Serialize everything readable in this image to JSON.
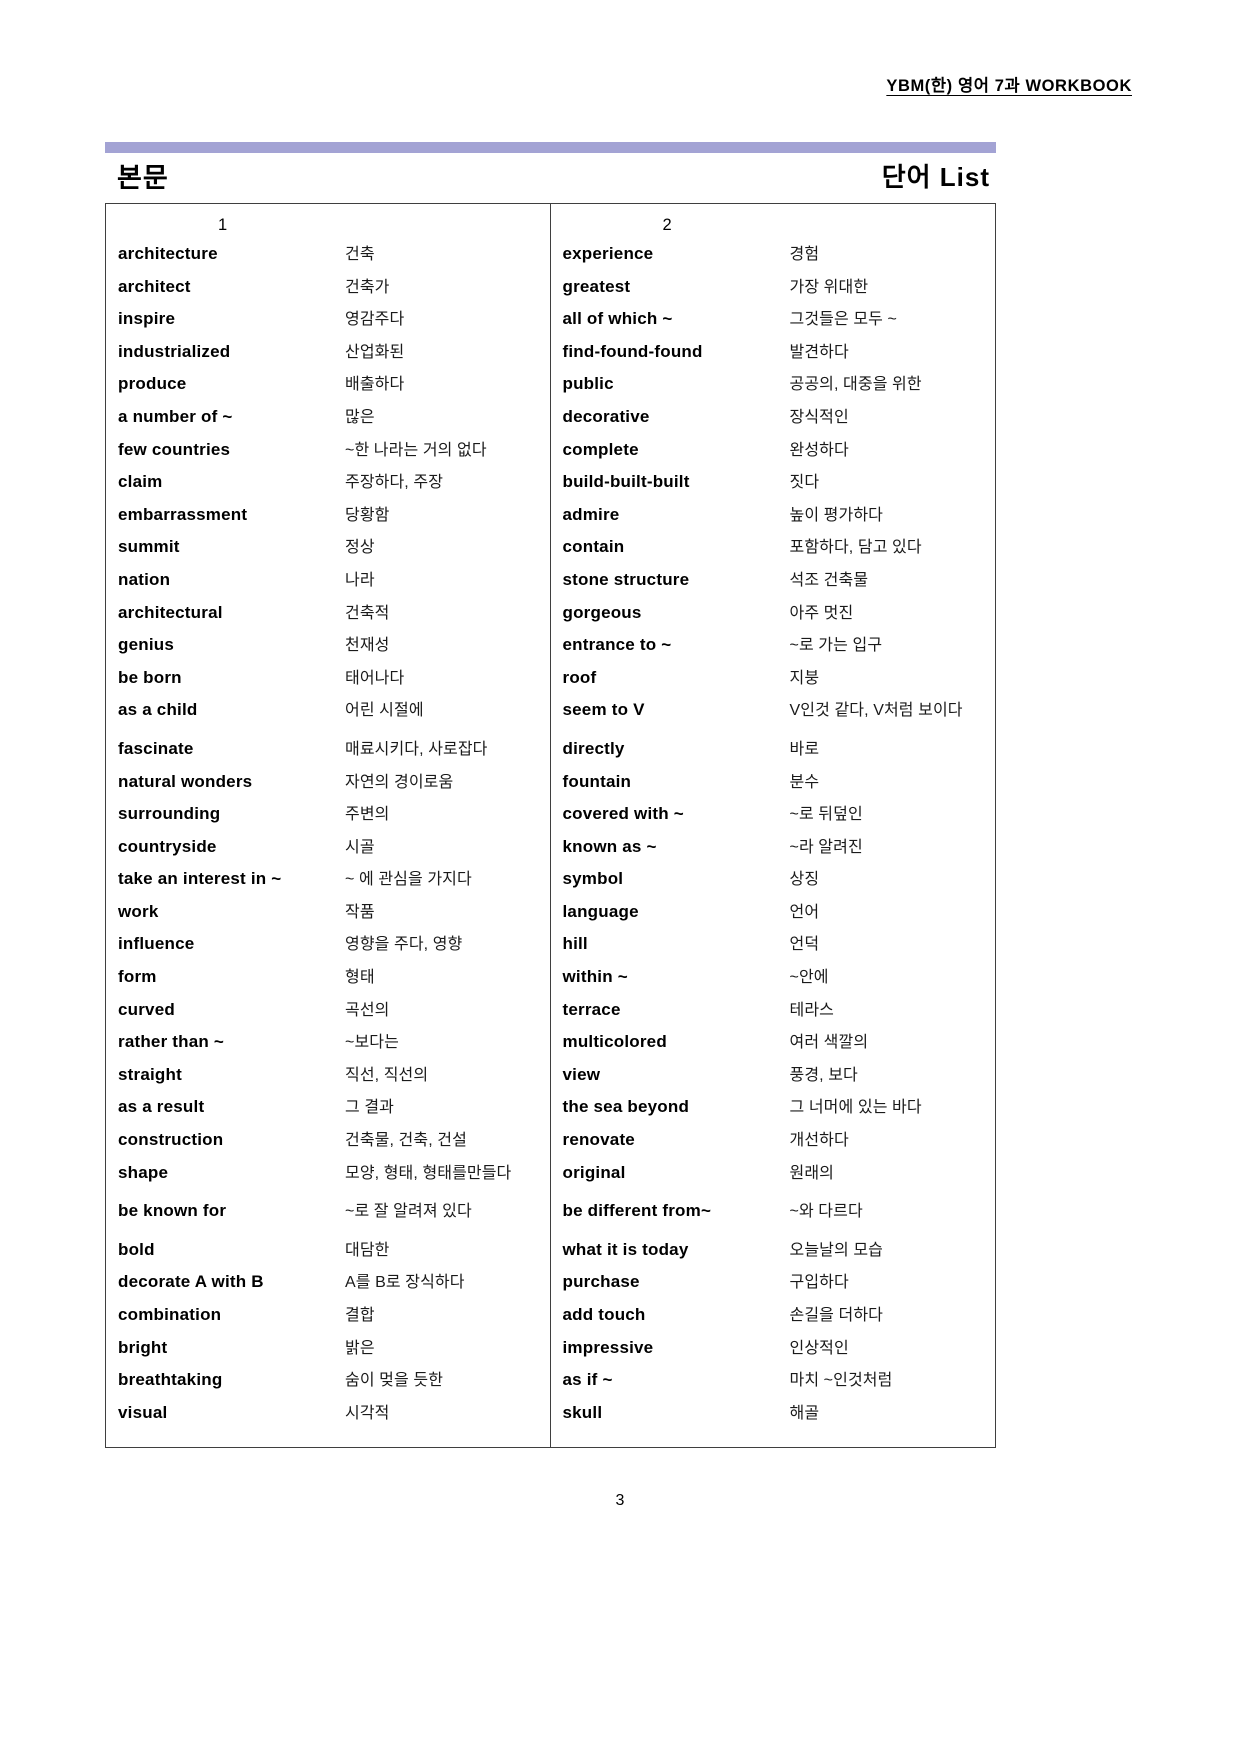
{
  "header": {
    "running_title": "YBM(한) 영어 7과 WORKBOOK"
  },
  "title": {
    "left": "본문",
    "right": "단어  List"
  },
  "columns": [
    {
      "number": "1",
      "entries": [
        {
          "term": "architecture",
          "gloss": "건축"
        },
        {
          "term": "architect",
          "gloss": "건축가"
        },
        {
          "term": "inspire",
          "gloss": "영감주다"
        },
        {
          "term": "industrialized",
          "gloss": "산업화된"
        },
        {
          "term": "produce",
          "gloss": "배출하다"
        },
        {
          "term": "a number of ~",
          "gloss": "많은"
        },
        {
          "term": "few countries",
          "gloss": "~한 나라는 거의 없다"
        },
        {
          "term": "claim",
          "gloss": "주장하다, 주장"
        },
        {
          "term": "embarrassment",
          "gloss": "당황함"
        },
        {
          "term": "summit",
          "gloss": "정상"
        },
        {
          "term": "nation",
          "gloss": "나라"
        },
        {
          "term": "architectural",
          "gloss": "건축적"
        },
        {
          "term": "genius",
          "gloss": "천재성"
        },
        {
          "term": "be born",
          "gloss": "태어나다"
        },
        {
          "term": "as a child",
          "gloss": "어린 시절에",
          "tall": true
        },
        {
          "term": "fascinate",
          "gloss": "매료시키다, 사로잡다"
        },
        {
          "term": "natural wonders",
          "gloss": "자연의 경이로움"
        },
        {
          "term": "surrounding",
          "gloss": "주변의"
        },
        {
          "term": "countryside",
          "gloss": "시골"
        },
        {
          "term": "take an interest in ~",
          "gloss": "~ 에 관심을 가지다"
        },
        {
          "term": "work",
          "gloss": "작품"
        },
        {
          "term": "influence",
          "gloss": "영향을 주다, 영향"
        },
        {
          "term": "form",
          "gloss": "형태"
        },
        {
          "term": "curved",
          "gloss": "곡선의"
        },
        {
          "term": "rather than ~",
          "gloss": "~보다는"
        },
        {
          "term": "straight",
          "gloss": "직선, 직선의"
        },
        {
          "term": "as a result",
          "gloss": "그 결과"
        },
        {
          "term": "construction",
          "gloss": "건축물, 건축, 건설"
        },
        {
          "term": "shape",
          "gloss": "모양, 형태, 형태를만들다",
          "tall": true
        },
        {
          "term": "be known for",
          "gloss": "~로 잘 알려져 있다",
          "tall": true
        },
        {
          "term": "bold",
          "gloss": "대담한"
        },
        {
          "term": "decorate A with B",
          "gloss": "A를 B로 장식하다"
        },
        {
          "term": "combination",
          "gloss": "결합"
        },
        {
          "term": "bright",
          "gloss": "밝은"
        },
        {
          "term": "breathtaking",
          "gloss": "숨이 멎을 듯한"
        },
        {
          "term": "visual",
          "gloss": "시각적"
        }
      ]
    },
    {
      "number": "2",
      "entries": [
        {
          "term": "experience",
          "gloss": "경험"
        },
        {
          "term": "greatest",
          "gloss": "가장 위대한"
        },
        {
          "term": "all of which ~",
          "gloss": "그것들은 모두 ~"
        },
        {
          "term": "find-found-found",
          "gloss": "발견하다"
        },
        {
          "term": "public",
          "gloss": "공공의, 대중을 위한"
        },
        {
          "term": "decorative",
          "gloss": "장식적인"
        },
        {
          "term": "complete",
          "gloss": "완성하다"
        },
        {
          "term": "build-built-built",
          "gloss": "짓다"
        },
        {
          "term": "admire",
          "gloss": "높이 평가하다"
        },
        {
          "term": "contain",
          "gloss": "포함하다, 담고 있다"
        },
        {
          "term": "stone structure",
          "gloss": "석조 건축물"
        },
        {
          "term": "gorgeous",
          "gloss": "아주 멋진"
        },
        {
          "term": "entrance to ~",
          "gloss": "~로 가는 입구"
        },
        {
          "term": "roof",
          "gloss": "지붕"
        },
        {
          "term": "seem to V",
          "gloss": "V인것 같다, V처럼 보이다",
          "tall": true
        },
        {
          "term": "directly",
          "gloss": "바로"
        },
        {
          "term": "fountain",
          "gloss": "분수"
        },
        {
          "term": "covered with ~",
          "gloss": "~로 뒤덮인"
        },
        {
          "term": "known as ~",
          "gloss": "~라 알려진"
        },
        {
          "term": "symbol",
          "gloss": "상징"
        },
        {
          "term": "language",
          "gloss": "언어"
        },
        {
          "term": "hill",
          "gloss": "언덕"
        },
        {
          "term": "within ~",
          "gloss": "~안에"
        },
        {
          "term": "terrace",
          "gloss": "테라스"
        },
        {
          "term": "multicolored",
          "gloss": "여러 색깔의"
        },
        {
          "term": "view",
          "gloss": "풍경, 보다"
        },
        {
          "term": "the sea beyond",
          "gloss": "그 너머에 있는 바다"
        },
        {
          "term": "renovate",
          "gloss": "개선하다"
        },
        {
          "term": "original",
          "gloss": "원래의",
          "tall": true
        },
        {
          "term": "be different from~",
          "gloss": "~와 다르다",
          "tall": true
        },
        {
          "term": "what it is today",
          "gloss": "오늘날의 모습"
        },
        {
          "term": "purchase",
          "gloss": "구입하다"
        },
        {
          "term": "add touch",
          "gloss": "손길을 더하다"
        },
        {
          "term": "impressive",
          "gloss": "인상적인"
        },
        {
          "term": "as if ~",
          "gloss": "마치 ~인것처럼"
        },
        {
          "term": "skull",
          "gloss": "해골"
        }
      ]
    }
  ],
  "footer": {
    "page_number": "3"
  },
  "colors": {
    "title_band": "#a3a3d4",
    "table_border": "#3f3f3f"
  }
}
